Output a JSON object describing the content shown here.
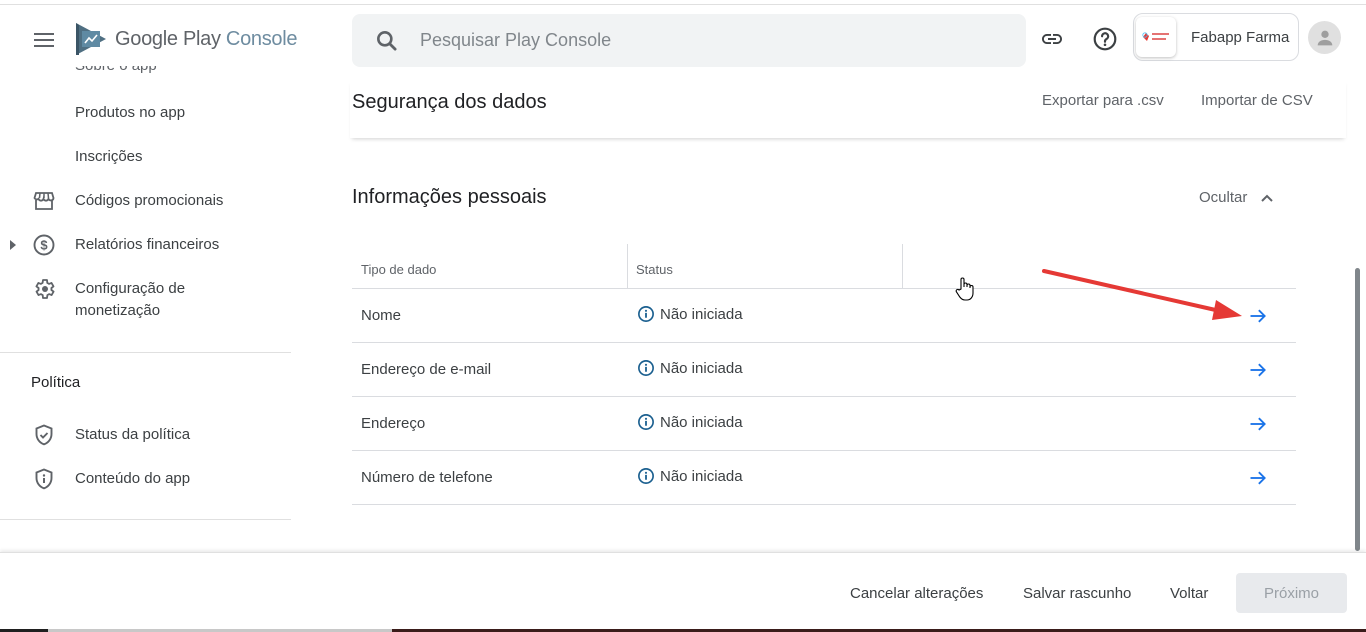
{
  "header": {
    "logo_text_primary": "Google Play",
    "logo_text_secondary": "Console",
    "search_placeholder": "Pesquisar Play Console",
    "search_value": "",
    "account_name": "Fabapp Farma",
    "app_icon_text": "FABAPP FARMA"
  },
  "sidebar": {
    "cut_item_label": "Sobre o app",
    "items": [
      {
        "label": "Produtos no app",
        "icon": "none"
      },
      {
        "label": "Inscrições",
        "icon": "none"
      },
      {
        "label": "Códigos promocionais",
        "icon": "storefront-icon"
      },
      {
        "label": "Relatórios financeiros",
        "icon": "dollar-circle-icon",
        "expandable": true
      },
      {
        "label": "Configuração de monetização",
        "icon": "gear-icon"
      }
    ],
    "sections": [
      {
        "title": "Política",
        "items": [
          {
            "label": "Status da política",
            "icon": "shield-check-icon"
          },
          {
            "label": "Conteúdo do app",
            "icon": "shield-info-icon"
          }
        ]
      }
    ]
  },
  "main": {
    "page_title": "Segurança dos dados",
    "export_label": "Exportar para .csv",
    "import_label": "Importar de CSV",
    "section_title": "Informações pessoais",
    "hide_label": "Ocultar",
    "table": {
      "columns": [
        "Tipo de dado",
        "Status",
        ""
      ],
      "rows": [
        {
          "type": "Nome",
          "status": "Não iniciada"
        },
        {
          "type": "Endereço de e-mail",
          "status": "Não iniciada"
        },
        {
          "type": "Endereço",
          "status": "Não iniciada"
        },
        {
          "type": "Número de telefone",
          "status": "Não iniciada"
        }
      ]
    }
  },
  "footer": {
    "cancel_label": "Cancelar alterações",
    "save_draft_label": "Salvar rascunho",
    "back_label": "Voltar",
    "next_label": "Próximo",
    "next_disabled": true
  },
  "colors": {
    "accent_blue": "#1a73e8",
    "status_icon": "#1a5f8f",
    "annotation_red": "#e53935"
  }
}
